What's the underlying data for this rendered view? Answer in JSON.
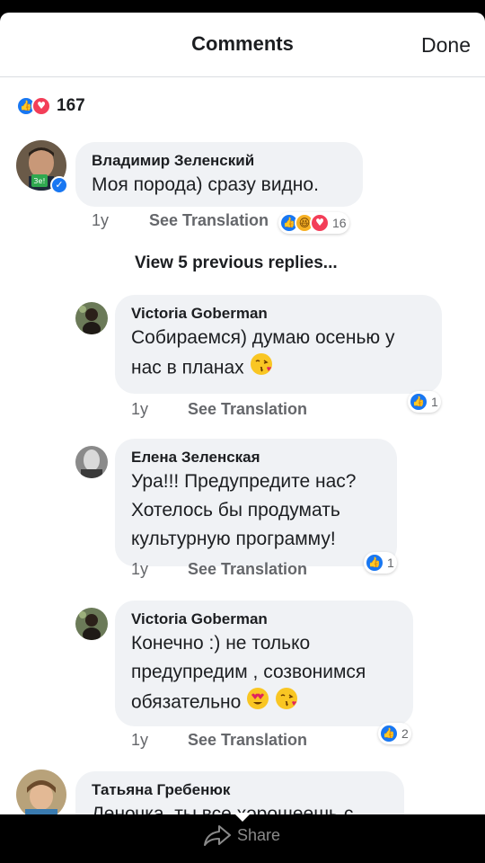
{
  "header": {
    "title": "Comments",
    "done_label": "Done"
  },
  "totals": {
    "count": "167"
  },
  "comments": [
    {
      "author": "Владимир Зеленский",
      "text": "Моя порода) сразу видно.",
      "time": "1y",
      "translate_label": "See Translation",
      "reaction_count": "16",
      "avatar_label": "Зе!"
    },
    {
      "author": "Victoria Goberman",
      "text_line1": "Собираемся) думаю осенью у",
      "text_line2": "нас в планах",
      "time": "1y",
      "translate_label": "See Translation",
      "reaction_count": "1"
    },
    {
      "author": "Елена Зеленская",
      "text_line1": "Ура!!! Предупредите нас?",
      "text_line2": "Хотелось бы продумать",
      "text_line3": "культурную программу!",
      "time": "1y",
      "translate_label": "See Translation",
      "reaction_count": "1"
    },
    {
      "author": "Victoria Goberman",
      "text_line1": "Конечно :) не только",
      "text_line2": "предупредим , созвонимся",
      "text_line3": "обязательно",
      "time": "1y",
      "translate_label": "See Translation",
      "reaction_count": "2"
    },
    {
      "author": "Татьяна Гребенюк",
      "text": "Леночка, ты все хорошеешь с"
    }
  ],
  "view_previous_label": "View 5 previous replies...",
  "bottom_bar": {
    "share_label": "Share"
  },
  "colors": {
    "like": "#1877f2",
    "love": "#f33e58",
    "haha": "#f7b125",
    "bubble": "#f0f2f5"
  }
}
